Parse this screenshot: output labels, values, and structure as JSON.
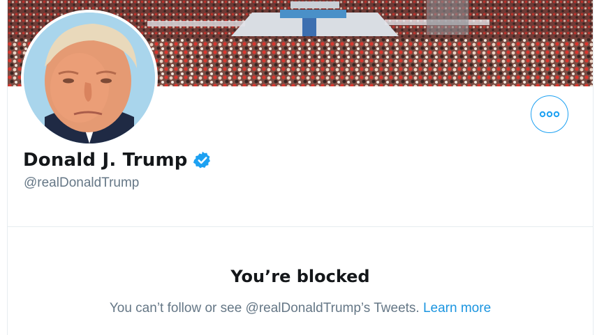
{
  "profile": {
    "display_name": "Donald J. Trump",
    "handle": "@realDonaldTrump",
    "verified": true,
    "banner_image": "rally-crowd-photo",
    "avatar_image": "profile-photo"
  },
  "actions": {
    "more_icon": "ellipsis-icon"
  },
  "blocked": {
    "title": "You’re blocked",
    "message": "You can’t follow or see @realDonaldTrump’s Tweets.",
    "link_label": "Learn more"
  },
  "colors": {
    "accent": "#1da1f2",
    "link": "#1b95e0",
    "text_primary": "#14171a",
    "text_secondary": "#657786",
    "border": "#e6ecf0"
  }
}
